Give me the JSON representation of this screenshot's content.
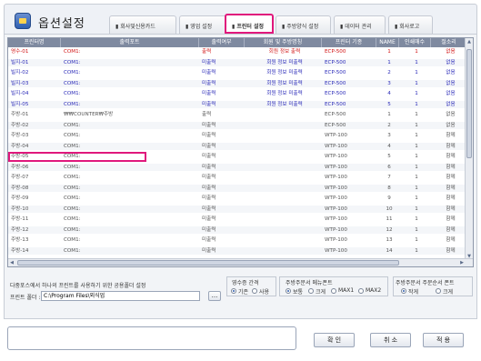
{
  "window": {
    "title": "옵션설정"
  },
  "tabs": [
    {
      "label": "▮ 회사및신용카드"
    },
    {
      "label": "▮ 영업 설정"
    },
    {
      "label": "▮ 프린터 설정"
    },
    {
      "label": "▮ 주방양식 설정"
    },
    {
      "label": "▮ 데이터 관리"
    },
    {
      "label": "▮ 회사로고"
    }
  ],
  "columns": [
    "프린터명",
    "출력포트",
    "출력여부",
    "회원 및 주방명칭",
    "프린터 기종",
    "NAME",
    "인쇄매수",
    "절소리"
  ],
  "rows": [
    {
      "c": [
        "영수-01",
        "COM1:",
        "출력",
        "회원 정보 출력",
        "ECP-500",
        "1",
        "1",
        "없음"
      ],
      "color": "#d21414"
    },
    {
      "c": [
        "빌지-01",
        "COM1:",
        "미출력",
        "회원 정보 미출력",
        "ECP-500",
        "1",
        "1",
        "없음"
      ],
      "color": "#2a2ab8"
    },
    {
      "c": [
        "빌지-02",
        "COM1:",
        "미출력",
        "회원 정보 미출력",
        "ECP-500",
        "2",
        "1",
        "없음"
      ],
      "color": "#2a2ab8"
    },
    {
      "c": [
        "빌지-03",
        "COM1:",
        "미출력",
        "회원 정보 미출력",
        "ECP-500",
        "3",
        "1",
        "없음"
      ],
      "color": "#2a2ab8"
    },
    {
      "c": [
        "빌지-04",
        "COM1:",
        "미출력",
        "회원 정보 미출력",
        "ECP-500",
        "4",
        "1",
        "없음"
      ],
      "color": "#2a2ab8"
    },
    {
      "c": [
        "빌지-05",
        "COM1:",
        "미출력",
        "회원 정보 미출력",
        "ECP-500",
        "5",
        "1",
        "없음"
      ],
      "color": "#2a2ab8"
    },
    {
      "c": [
        "주방-01",
        "₩₩COUNTER₩주방",
        "출력",
        "",
        "ECP-500",
        "1",
        "1",
        "없음"
      ],
      "color": "#555555"
    },
    {
      "c": [
        "주방-02",
        "COM1:",
        "미출력",
        "",
        "ECP-500",
        "2",
        "1",
        "없음"
      ],
      "color": "#555555"
    },
    {
      "c": [
        "주방-03",
        "COM1:",
        "미출력",
        "",
        "WTP-100",
        "3",
        "1",
        "함께"
      ],
      "color": "#555555"
    },
    {
      "c": [
        "주방-04",
        "COM1:",
        "미출력",
        "",
        "WTP-100",
        "4",
        "1",
        "함께"
      ],
      "color": "#555555"
    },
    {
      "c": [
        "주방-05",
        "COM1:",
        "미출력",
        "",
        "WTP-100",
        "5",
        "1",
        "함께"
      ],
      "color": "#555555"
    },
    {
      "c": [
        "주방-06",
        "COM1:",
        "미출력",
        "",
        "WTP-100",
        "6",
        "1",
        "함께"
      ],
      "color": "#555555"
    },
    {
      "c": [
        "주방-07",
        "COM1:",
        "미출력",
        "",
        "WTP-100",
        "7",
        "1",
        "함께"
      ],
      "color": "#555555"
    },
    {
      "c": [
        "주방-08",
        "COM1:",
        "미출력",
        "",
        "WTP-100",
        "8",
        "1",
        "함께"
      ],
      "color": "#555555"
    },
    {
      "c": [
        "주방-09",
        "COM1:",
        "미출력",
        "",
        "WTP-100",
        "9",
        "1",
        "함께"
      ],
      "color": "#555555"
    },
    {
      "c": [
        "주방-10",
        "COM1:",
        "미출력",
        "",
        "WTP-100",
        "10",
        "1",
        "함께"
      ],
      "color": "#555555"
    },
    {
      "c": [
        "주방-11",
        "COM1:",
        "미출력",
        "",
        "WTP-100",
        "11",
        "1",
        "함께"
      ],
      "color": "#555555"
    },
    {
      "c": [
        "주방-12",
        "COM1:",
        "미출력",
        "",
        "WTP-100",
        "12",
        "1",
        "함께"
      ],
      "color": "#555555"
    },
    {
      "c": [
        "주방-13",
        "COM1:",
        "미출력",
        "",
        "WTP-100",
        "13",
        "1",
        "함께"
      ],
      "color": "#555555"
    },
    {
      "c": [
        "주방-14",
        "COM1:",
        "미출력",
        "",
        "WTP-100",
        "14",
        "1",
        "함께"
      ],
      "color": "#555555"
    }
  ],
  "shared": {
    "caption": "다중포스에서 하나의 프린트를 사용하기 위한 공용폴더 설정",
    "folder_label": "프린트 폴더 :",
    "folder_value": "C:\\Program Files\\외식업",
    "browse": "..."
  },
  "spacing": {
    "title": "영수증 간격",
    "options": [
      "기존",
      "사용"
    ],
    "selected": 0
  },
  "kitchen_menu_font": {
    "title": "주방주문서 메뉴폰트",
    "options": [
      "보통",
      "크게",
      "MAX1",
      "MAX2"
    ],
    "selected": 0
  },
  "kitchen_order_font": {
    "title": "주방주문서 주문순서 폰트",
    "options": [
      "작게",
      "크게"
    ],
    "selected": 0
  },
  "buttons": {
    "ok": "확 인",
    "cancel": "취 소",
    "apply": "적 용"
  },
  "status_text": "",
  "colors": {
    "accent": "#e0187c",
    "header_bg": "#7f8aa0"
  }
}
